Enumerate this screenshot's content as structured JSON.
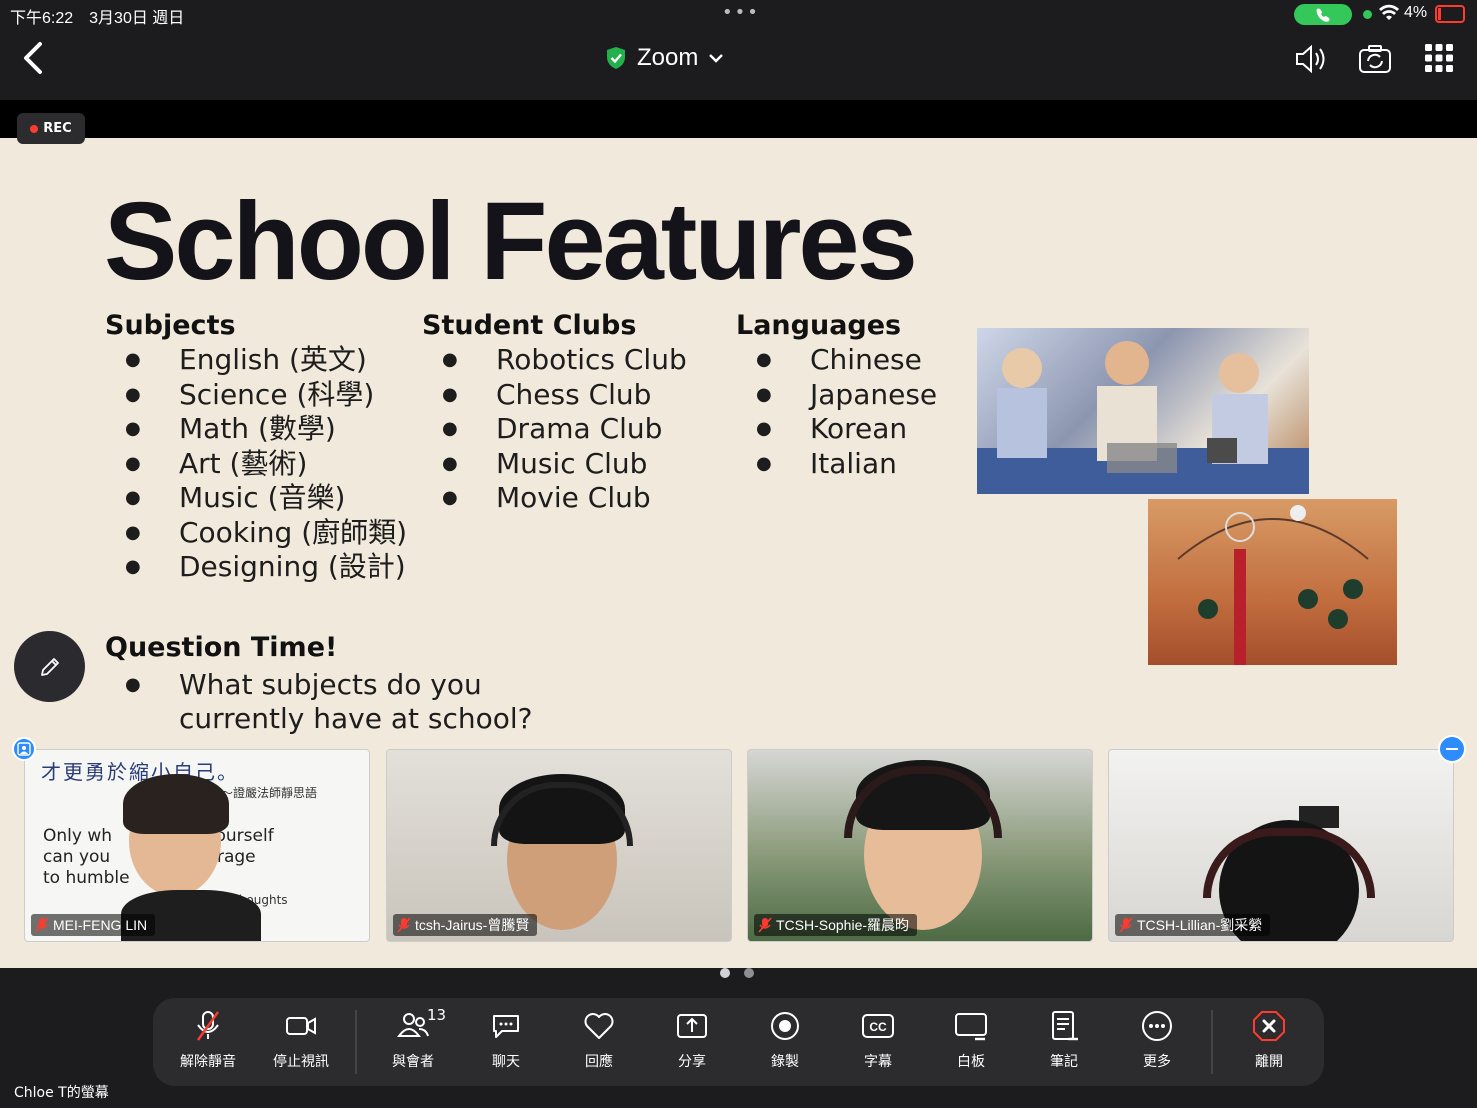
{
  "status_bar": {
    "time": "下午6:22　3月30日 週日",
    "battery_percent": "4%",
    "dots": "•••"
  },
  "header": {
    "title": "Zoom"
  },
  "recording": {
    "label": "REC"
  },
  "slide": {
    "title": "School Features",
    "columns": [
      {
        "heading": "Subjects",
        "items": [
          "English (英文)",
          "Science (科學)",
          "Math (數學)",
          "Art (藝術)",
          "Music (音樂)",
          "Cooking (廚師類)",
          "Designing (設計)"
        ]
      },
      {
        "heading": "Student Clubs",
        "items": [
          "Robotics Club",
          "Chess Club",
          "Drama Club",
          "Music Club",
          "Movie Club"
        ]
      },
      {
        "heading": "Languages",
        "items": [
          "Chinese",
          "Japanese",
          "Korean",
          "Italian"
        ]
      }
    ],
    "question_title": "Question Time!",
    "question_line1": "What subjects do you",
    "question_line2": "currently have at school?"
  },
  "participants": [
    {
      "name": "MEI-FENG LIN"
    },
    {
      "name": "tcsh-Jairus-曾騰賢"
    },
    {
      "name": "TCSH-Sophie-羅晨昀"
    },
    {
      "name": "TCSH-Lillian-劉采縈"
    }
  ],
  "tile1_text": {
    "chinese": "才更勇於縮小自己。",
    "attribution": "～證嚴法師靜思語",
    "line1": "Only wh",
    "line1b": "ct yourself",
    "line2": "can you",
    "line2b": "urage",
    "line3": "to humble",
    "signature": "-Still Thoughts"
  },
  "toolbar": {
    "unmute": "解除靜音",
    "stop_video": "停止視訊",
    "participants": "與會者",
    "participants_count": "13",
    "chat": "聊天",
    "reactions": "回應",
    "share": "分享",
    "record": "錄製",
    "captions": "字幕",
    "whiteboard": "白板",
    "notes": "筆記",
    "more": "更多",
    "leave": "離開"
  },
  "footer": {
    "screen_owner": "Chloe T的螢幕"
  },
  "colors": {
    "accent": "#2d8cff",
    "slide_bg": "#f1eadc",
    "leave": "#ff3b30",
    "call": "#34c759"
  }
}
